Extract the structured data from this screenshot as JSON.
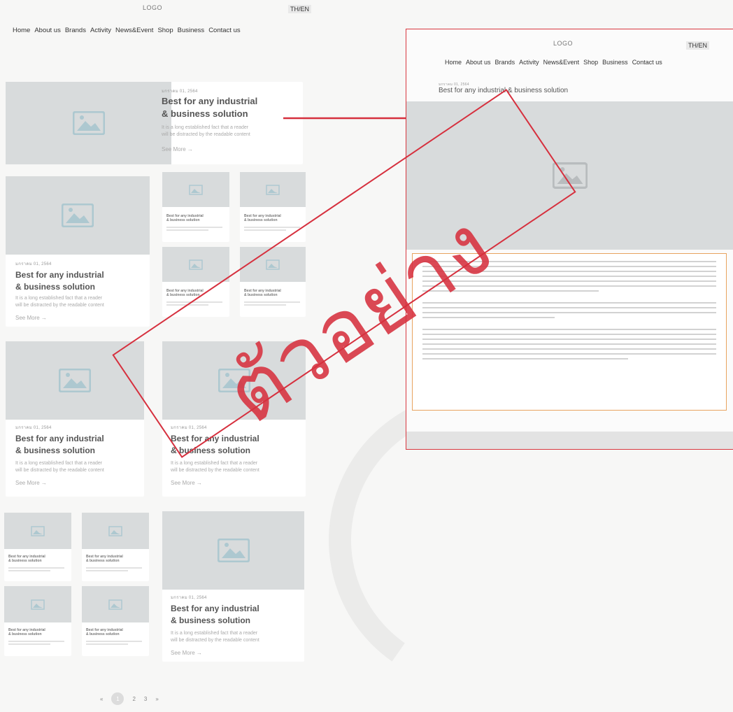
{
  "header": {
    "logo": "LOGO",
    "lang": "TH/EN"
  },
  "nav": [
    "Home",
    "About us",
    "Brands",
    "Activity",
    "News&Event",
    "Shop",
    "Business",
    "Contact us"
  ],
  "featured": {
    "date": "มกราคม 01, 2564",
    "title_line1": "Best for any industrial",
    "title_line2": "& business solution",
    "desc_line1": "It is a long established fact that a reader",
    "desc_line2": "will be distracted by the readable content",
    "more": "See More →"
  },
  "small_card": {
    "title_line1": "Best for any industrial",
    "title_line2": "& business solution"
  },
  "pagination": {
    "prev": "«",
    "pages": [
      "1",
      "2",
      "3"
    ],
    "next": "»"
  },
  "detail": {
    "logo": "LOGO",
    "lang": "TH/EN",
    "nav": [
      "Home",
      "About us",
      "Brands",
      "Activity",
      "News&Event",
      "Shop",
      "Business",
      "Contact us"
    ],
    "date": "มกราคม 01, 2564",
    "title": "Best for any industrial & business solution"
  },
  "stamp": {
    "text": "ตัวอย่าง"
  },
  "colors": {
    "accent_red": "#d6303e",
    "placeholder": "#d8dbdc",
    "orange_frame": "#e8a35f"
  }
}
